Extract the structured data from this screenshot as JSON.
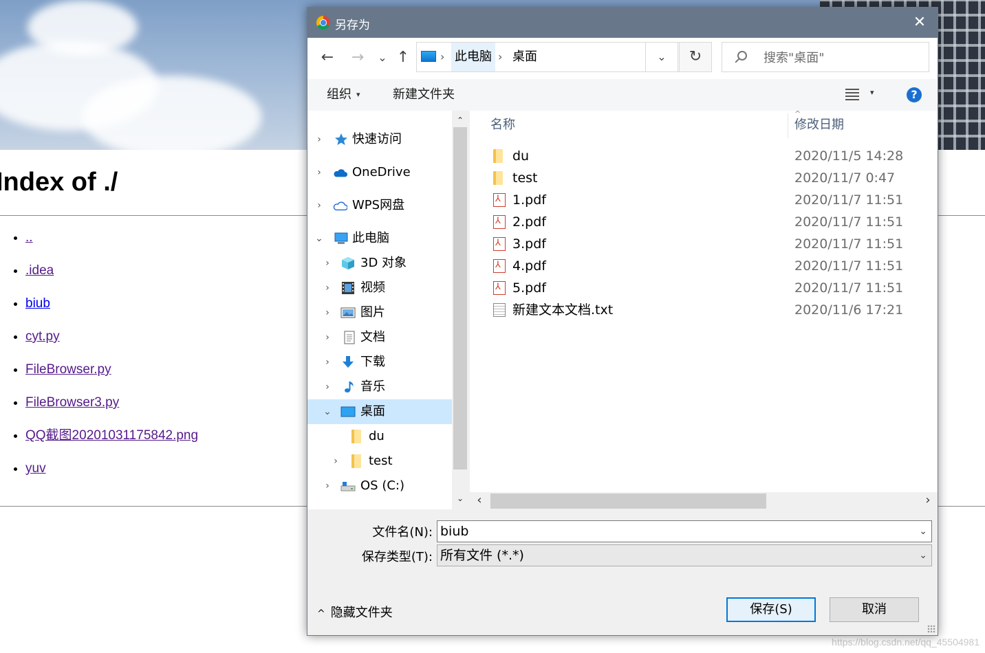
{
  "browser_page": {
    "heading": "Index of ./",
    "files": [
      {
        "label": ".."
      },
      {
        "label": ".idea"
      },
      {
        "label": "biub"
      },
      {
        "label": "cyt.py"
      },
      {
        "label": "FileBrowser.py"
      },
      {
        "label": "FileBrowser3.py"
      },
      {
        "label": "QQ截图20201031175842.png"
      },
      {
        "label": "yuv"
      }
    ],
    "watermark": "https://blog.csdn.net/qq_45504981"
  },
  "dialog": {
    "title": "另存为",
    "close_glyph": "✕",
    "nav": {
      "back": "←",
      "forward": "→",
      "recent": "⌄",
      "up": "↑"
    },
    "breadcrumb": [
      "此电脑",
      "桌面"
    ],
    "breadcrumb_sep": "›",
    "address_dropdown": "⌄",
    "refresh": "↻",
    "search": {
      "placeholder": "搜索\"桌面\""
    },
    "toolbar": {
      "organize": "组织",
      "new_folder": "新建文件夹",
      "caret": "▾",
      "help": "?"
    },
    "nav_pane": [
      {
        "label": "快速访问",
        "icon": "star-icon",
        "expander": "›"
      },
      {
        "label": "OneDrive",
        "icon": "cloud-icon",
        "expander": "›"
      },
      {
        "label": "WPS网盘",
        "icon": "cloud-outline-icon",
        "expander": "›"
      },
      {
        "label": "此电脑",
        "icon": "computer-icon",
        "expander": "⌄"
      },
      {
        "label": "3D 对象",
        "icon": "cube-icon",
        "expander": "›"
      },
      {
        "label": "视频",
        "icon": "video-icon",
        "expander": "›"
      },
      {
        "label": "图片",
        "icon": "picture-icon",
        "expander": "›"
      },
      {
        "label": "文档",
        "icon": "document-icon",
        "expander": "›"
      },
      {
        "label": "下载",
        "icon": "download-icon",
        "expander": "›"
      },
      {
        "label": "音乐",
        "icon": "music-icon",
        "expander": "›"
      },
      {
        "label": "桌面",
        "icon": "desktop-icon",
        "expander": "⌄",
        "selected": true
      },
      {
        "label": "du",
        "icon": "folder-icon",
        "expander": ""
      },
      {
        "label": "test",
        "icon": "folder-icon",
        "expander": "›"
      },
      {
        "label": "OS (C:)",
        "icon": "drive-icon",
        "expander": "›"
      }
    ],
    "scroll": {
      "up": "⌃",
      "down": "⌄",
      "left": "‹",
      "right": "›"
    },
    "columns": {
      "name": "名称",
      "modified": "修改日期",
      "sort_caret": "^"
    },
    "files": [
      {
        "name": "du",
        "date": "2020/11/5 14:28",
        "type": "folder"
      },
      {
        "name": "test",
        "date": "2020/11/7 0:47",
        "type": "folder"
      },
      {
        "name": "1.pdf",
        "date": "2020/11/7 11:51",
        "type": "pdf"
      },
      {
        "name": "2.pdf",
        "date": "2020/11/7 11:51",
        "type": "pdf"
      },
      {
        "name": "3.pdf",
        "date": "2020/11/7 11:51",
        "type": "pdf"
      },
      {
        "name": "4.pdf",
        "date": "2020/11/7 11:51",
        "type": "pdf"
      },
      {
        "name": "5.pdf",
        "date": "2020/11/7 11:51",
        "type": "pdf"
      },
      {
        "name": "新建文本文档.txt",
        "date": "2020/11/6 17:21",
        "type": "txt"
      }
    ],
    "form": {
      "filename_label": "文件名(N):",
      "filename_value": "biub",
      "filetype_label": "保存类型(T):",
      "filetype_value": "所有文件 (*.*)",
      "dropdown_glyph": "⌄"
    },
    "hide_folders": {
      "label": "隐藏文件夹",
      "glyph": "^"
    },
    "buttons": {
      "save": "保存(S)",
      "cancel": "取消"
    }
  },
  "colors": {
    "accent": "#0078d7",
    "titlebar": "#687789",
    "selected": "#cce8ff",
    "visited_link": "#551a8b"
  }
}
